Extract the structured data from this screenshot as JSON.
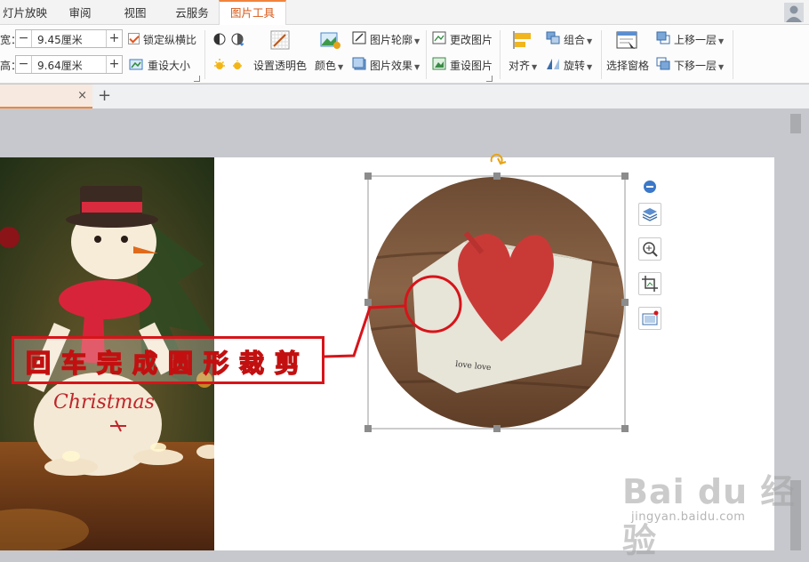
{
  "tabs": [
    {
      "label": "灯片放映"
    },
    {
      "label": "审阅"
    },
    {
      "label": "视图"
    },
    {
      "label": "云服务"
    },
    {
      "label": "图片工具",
      "active": true
    }
  ],
  "size": {
    "width_label": "宽：",
    "width_value": "9.45厘米",
    "height_label": "高：",
    "height_value": "9.64厘米",
    "lock_ratio_label": "锁定纵横比",
    "reset_size_label": "重设大小"
  },
  "ribbon": {
    "set_transparent": "设置透明色",
    "color": "颜色",
    "picture_outline": "图片轮廓",
    "picture_effect": "图片效果",
    "change_picture": "更改图片",
    "reset_picture": "重设图片",
    "align": "对齐",
    "group": "组合",
    "rotate": "旋转",
    "selection_pane": "选择窗格",
    "bring_forward": "上移一层",
    "send_backward": "下移一层"
  },
  "doc": {
    "close": "×",
    "new_tab": "+"
  },
  "canvas": {
    "caption": "回车完成圆形裁剪",
    "snowman_text": "Christmas",
    "card_text": "love love"
  },
  "watermark": {
    "brand": "Bai du 经验",
    "url": "jingyan.baidu.com"
  },
  "colors": {
    "accent": "#f0843c",
    "annotation_red": "#d7141a"
  }
}
